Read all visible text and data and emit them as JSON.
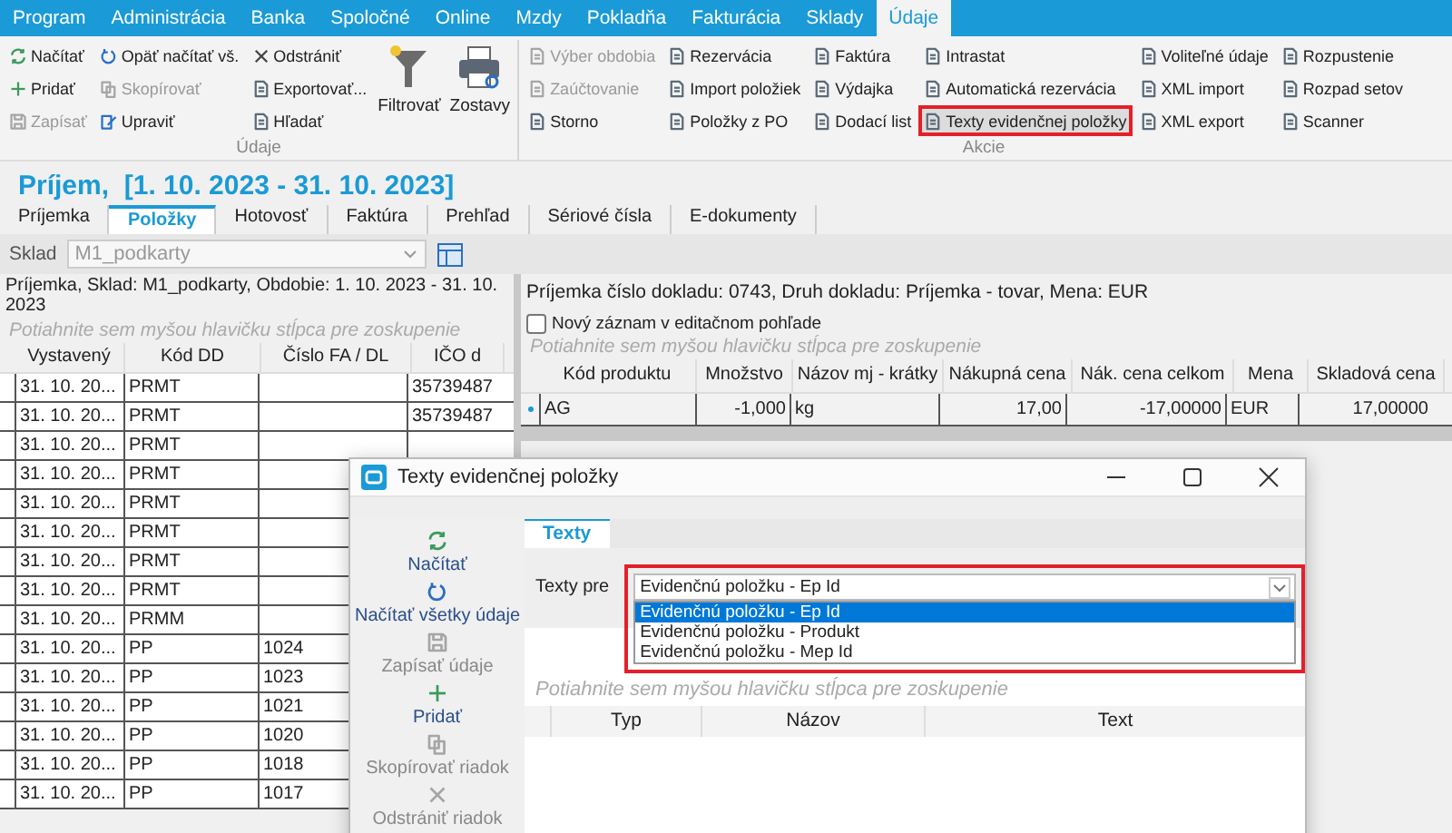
{
  "menu": [
    {
      "label": "Program",
      "selected": false
    },
    {
      "label": "Administrácia",
      "selected": false
    },
    {
      "label": "Banka",
      "selected": false
    },
    {
      "label": "Spoločné",
      "selected": false
    },
    {
      "label": "Online",
      "selected": false
    },
    {
      "label": "Mzdy",
      "selected": false
    },
    {
      "label": "Pokladňa",
      "selected": false
    },
    {
      "label": "Fakturácia",
      "selected": false
    },
    {
      "label": "Sklady",
      "selected": false
    },
    {
      "label": "Údaje",
      "selected": true
    }
  ],
  "ribbon": {
    "groups": [
      {
        "label": "Údaje",
        "columns": [
          [
            {
              "label": "Načítať",
              "disabled": false,
              "highlighted": false
            },
            {
              "label": "Pridať",
              "disabled": false,
              "highlighted": false
            },
            {
              "label": "Zapísať",
              "disabled": true,
              "highlighted": false
            }
          ],
          [
            {
              "label": "Opäť načítať vš.",
              "disabled": false,
              "highlighted": false
            },
            {
              "label": "Skopírovať",
              "disabled": true,
              "highlighted": false
            },
            {
              "label": "Upraviť",
              "disabled": false,
              "highlighted": false
            }
          ],
          [
            {
              "label": "Odstrániť",
              "disabled": false,
              "highlighted": false
            },
            {
              "label": "Exportovať...",
              "disabled": false,
              "highlighted": false
            },
            {
              "label": "Hľadať",
              "disabled": false,
              "highlighted": false
            }
          ]
        ],
        "large": [
          {
            "label": "Filtrovať"
          },
          {
            "label": "Zostavy"
          }
        ]
      },
      {
        "label": "Akcie",
        "columns": [
          [
            {
              "label": "Výber obdobia",
              "disabled": true,
              "highlighted": false
            },
            {
              "label": "Zaúčtovanie",
              "disabled": true,
              "highlighted": false
            },
            {
              "label": "Storno",
              "disabled": false,
              "highlighted": false
            }
          ],
          [
            {
              "label": "Rezervácia",
              "disabled": false,
              "highlighted": false
            },
            {
              "label": "Import položiek",
              "disabled": false,
              "highlighted": false
            },
            {
              "label": "Položky z PO",
              "disabled": false,
              "highlighted": false
            }
          ],
          [
            {
              "label": "Faktúra",
              "disabled": false,
              "highlighted": false
            },
            {
              "label": "Výdajka",
              "disabled": false,
              "highlighted": false
            },
            {
              "label": "Dodací list",
              "disabled": false,
              "highlighted": false
            }
          ],
          [
            {
              "label": "Intrastat",
              "disabled": false,
              "highlighted": false
            },
            {
              "label": "Automatická rezervácia",
              "disabled": false,
              "highlighted": false
            },
            {
              "label": "Texty evidenčnej položky",
              "disabled": false,
              "highlighted": true
            }
          ],
          [
            {
              "label": "Voliteľné údaje",
              "disabled": false,
              "highlighted": false
            },
            {
              "label": "XML import",
              "disabled": false,
              "highlighted": false
            },
            {
              "label": "XML export",
              "disabled": false,
              "highlighted": false
            }
          ],
          [
            {
              "label": "Rozpustenie",
              "disabled": false,
              "highlighted": false
            },
            {
              "label": "Rozpad setov",
              "disabled": false,
              "highlighted": false
            },
            {
              "label": "Scanner",
              "disabled": false,
              "highlighted": false
            }
          ]
        ]
      }
    ]
  },
  "title": "Príjem,  [1. 10. 2023 - 31. 10. 2023]",
  "doc_tabs": [
    {
      "label": "Príjemka",
      "selected": false
    },
    {
      "label": "Položky",
      "selected": true
    },
    {
      "label": "Hotovosť",
      "selected": false
    },
    {
      "label": "Faktúra",
      "selected": false
    },
    {
      "label": "Prehľad",
      "selected": false
    },
    {
      "label": "Sériové čísla",
      "selected": false
    },
    {
      "label": "E-dokumenty",
      "selected": false
    }
  ],
  "sklad": {
    "label": "Sklad",
    "value": "M1_podkarty",
    "disabled": true
  },
  "left": {
    "info": "Príjemka, Sklad: M1_podkarty, Obdobie: 1. 10. 2023 - 31. 10. 2023",
    "group_hint": "Potiahnite sem myšou hlavičku stĺpca pre zoskupenie",
    "columns": [
      "Vystavený",
      "Kód DD",
      "Číslo FA / DL",
      "IČO d"
    ],
    "rows": [
      [
        "31. 10. 20...",
        "PRMT",
        "",
        "35739487"
      ],
      [
        "31. 10. 20...",
        "PRMT",
        "",
        "35739487"
      ],
      [
        "31. 10. 20...",
        "PRMT",
        "",
        ""
      ],
      [
        "31. 10. 20...",
        "PRMT",
        "",
        ""
      ],
      [
        "31. 10. 20...",
        "PRMT",
        "",
        ""
      ],
      [
        "31. 10. 20...",
        "PRMT",
        "",
        ""
      ],
      [
        "31. 10. 20...",
        "PRMT",
        "",
        ""
      ],
      [
        "31. 10. 20...",
        "PRMT",
        "",
        ""
      ],
      [
        "31. 10. 20...",
        "PRMM",
        "",
        ""
      ],
      [
        "31. 10. 20...",
        "PP",
        "1024",
        ""
      ],
      [
        "31. 10. 20...",
        "PP",
        "1023",
        ""
      ],
      [
        "31. 10. 20...",
        "PP",
        "1021",
        ""
      ],
      [
        "31. 10. 20...",
        "PP",
        "1020",
        ""
      ],
      [
        "31. 10. 20...",
        "PP",
        "1018",
        ""
      ],
      [
        "31. 10. 20...",
        "PP",
        "1017",
        ""
      ]
    ]
  },
  "right": {
    "info": "Príjemka číslo dokladu: 0743, Druh dokladu: Príjemka - tovar, Mena: EUR",
    "new_record": {
      "label": "Nový záznam v editačnom pohľade",
      "checked": false
    },
    "group_hint": "Potiahnite sem myšou hlavičku stĺpca pre zoskupenie",
    "columns": [
      "Kód produktu",
      "Množstvo",
      "Názov mj - krátky",
      "Nákupná cena",
      "Nák. cena celkom",
      "Mena",
      "Skladová cena"
    ],
    "rows": [
      [
        "AG",
        "-1,000",
        "kg",
        "17,00",
        "-17,00000",
        "EUR",
        "17,00000"
      ]
    ]
  },
  "dialog": {
    "title": "Texty evidenčnej položky",
    "toolbar": [
      {
        "label": "Načítať",
        "disabled": false
      },
      {
        "label": "Načítať všetky údaje",
        "disabled": false
      },
      {
        "label": "Zapísať údaje",
        "disabled": true
      },
      {
        "label": "Pridať",
        "disabled": false
      },
      {
        "label": "Skopírovať riadok",
        "disabled": true
      },
      {
        "label": "Odstrániť riadok",
        "disabled": true
      }
    ],
    "tabs": [
      {
        "label": "Texty",
        "selected": true
      }
    ],
    "texty_pre": {
      "label": "Texty pre",
      "value": "Evidenčnú položku - Ep Id",
      "expanded": true,
      "highlighted": true,
      "options": [
        {
          "label": "Evidenčnú položku - Ep Id",
          "selected": true
        },
        {
          "label": "Evidenčnú položku - Produkt",
          "selected": false
        },
        {
          "label": "Evidenčnú položku - Mep Id",
          "selected": false
        }
      ]
    },
    "group_hint": "Potiahnite sem myšou hlavičku stĺpca pre zoskupenie",
    "columns": [
      "Typ",
      "Názov",
      "Text"
    ]
  }
}
